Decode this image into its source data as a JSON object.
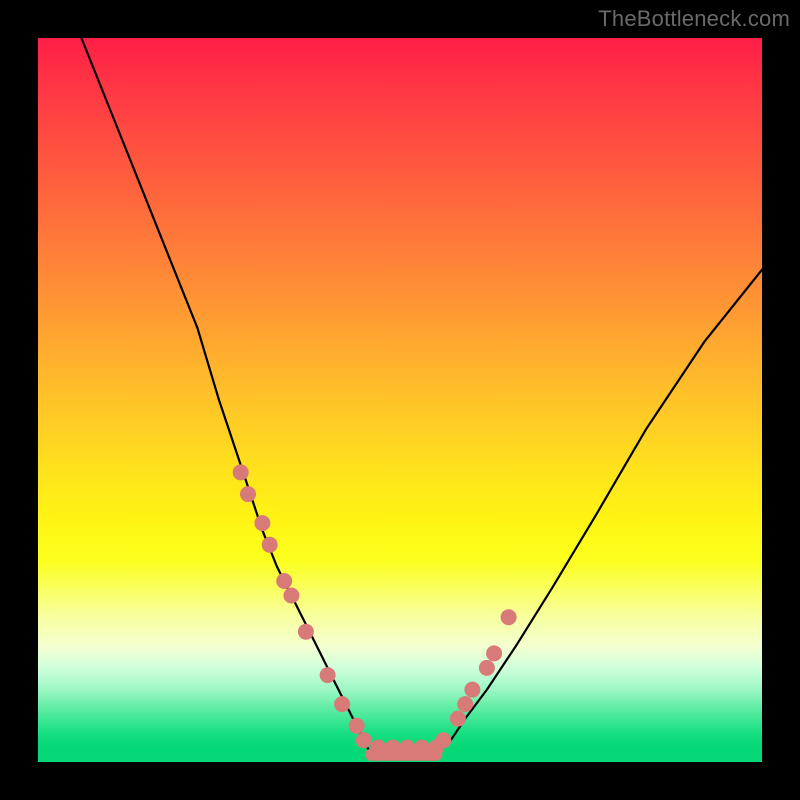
{
  "watermark": "TheBottleneck.com",
  "chart_data": {
    "type": "line",
    "title": "",
    "xlabel": "",
    "ylabel": "",
    "xlim": [
      0,
      100
    ],
    "ylim": [
      0,
      100
    ],
    "grid": false,
    "background_gradient": {
      "top": "#ff1f47",
      "mid": "#ffe31c",
      "bottom": "#05d876"
    },
    "series": [
      {
        "name": "bottleneck-curve-left",
        "x": [
          6,
          10,
          14,
          18,
          22,
          25,
          27,
          29,
          31,
          33,
          35,
          37,
          39,
          41,
          42,
          43,
          44,
          45,
          46
        ],
        "y": [
          100,
          90,
          80,
          70,
          60,
          50,
          44,
          38,
          32,
          27,
          23,
          19,
          15,
          11,
          9,
          7,
          5,
          3,
          1
        ]
      },
      {
        "name": "bottleneck-curve-flat",
        "x": [
          46,
          48,
          50,
          52,
          54,
          55
        ],
        "y": [
          1,
          1,
          1,
          1,
          1,
          1
        ]
      },
      {
        "name": "bottleneck-curve-right",
        "x": [
          55,
          57,
          59,
          62,
          66,
          71,
          77,
          84,
          92,
          100
        ],
        "y": [
          1,
          3,
          6,
          10,
          16,
          24,
          34,
          46,
          58,
          68
        ]
      }
    ],
    "points_overlay": {
      "name": "sample-dots",
      "color": "#d87a78",
      "x": [
        28,
        29,
        31,
        32,
        34,
        35,
        37,
        40,
        42,
        44,
        45,
        47,
        49,
        51,
        53,
        55,
        56,
        58,
        59,
        60,
        62,
        63,
        65
      ],
      "y": [
        40,
        37,
        33,
        30,
        25,
        23,
        18,
        12,
        8,
        5,
        3,
        2,
        2,
        2,
        2,
        2,
        3,
        6,
        8,
        10,
        13,
        15,
        20
      ]
    }
  }
}
